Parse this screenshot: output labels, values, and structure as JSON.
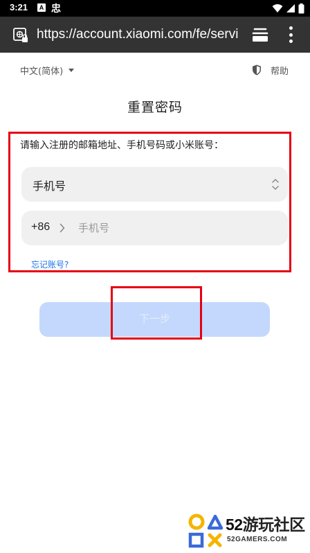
{
  "status_bar": {
    "time": "3:21",
    "notif_a": "A",
    "notif_b": "忠"
  },
  "browser": {
    "url": "https://account.xiaomi.com/fe/service/forgetPassword"
  },
  "header": {
    "language": "中文(简体)",
    "help": "帮助"
  },
  "page": {
    "title": "重置密码",
    "prompt": "请输入注册的邮箱地址、手机号码或小米账号：",
    "account_type": "手机号",
    "country_code": "+86",
    "phone_placeholder": "手机号",
    "forgot_link": "忘记账号?",
    "next_button": "下一步"
  },
  "watermark": {
    "number": "52",
    "name": "游玩社区",
    "site": "52GAMERS.COM"
  },
  "colors": {
    "accent_link": "#1a73e8",
    "button_disabled": "#c3d8fc",
    "highlight": "#e60012"
  }
}
